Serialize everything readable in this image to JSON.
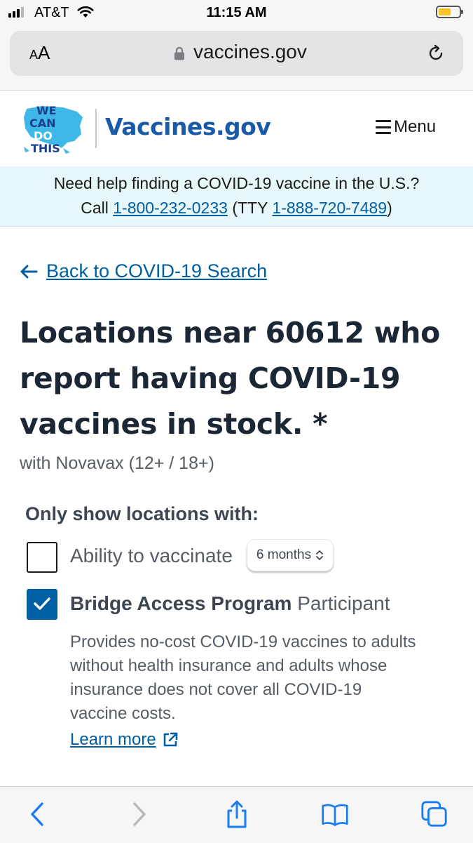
{
  "status_bar": {
    "carrier": "AT&T",
    "time": "11:15 AM"
  },
  "browser": {
    "text_size_label_small": "A",
    "text_size_label_large": "A",
    "url": "vaccines.gov"
  },
  "header": {
    "logo_text": [
      "WE",
      "CAN",
      "DO",
      "THIS"
    ],
    "site_title": "Vaccines.gov",
    "menu_label": "Menu"
  },
  "banner": {
    "line1": "Need help finding a COVID-19 vaccine in the U.S.?",
    "call_prefix": "Call",
    "phone": "1-800-232-0233",
    "tty_prefix": "(TTY",
    "tty_phone": "1-888-720-7489",
    "tty_suffix": ")"
  },
  "main": {
    "back_link": "Back to COVID-19 Search",
    "title_lines": [
      "Locations near 60612 who",
      "report having COVID-19",
      "vaccines in stock. *"
    ],
    "subtitle": "with Novavax (12+ / 18+)",
    "filter_legend": "Only show locations with:",
    "filter_age_label": "Ability to vaccinate",
    "filter_age_value": "6 months",
    "filter_bridge_bold": "Bridge Access Program",
    "filter_bridge_rest": "Participant",
    "bridge_desc_lines": [
      "Provides no-cost COVID-19 vaccines to adults",
      "without health insurance and adults whose",
      "insurance does not cover all COVID-19",
      "vaccine costs."
    ],
    "learn_more": "Learn more"
  },
  "colors": {
    "brand_blue": "#1a5aa8",
    "link_blue": "#005ea2",
    "banner_bg": "#e7f6f8",
    "checkbox_checked": "#005ea2",
    "battery": "#f7c52b"
  },
  "icons": [
    "signal-icon",
    "wifi-icon",
    "battery-icon",
    "lock-icon",
    "reload-icon",
    "menu-icon",
    "arrow-left-icon",
    "select-chevron-icon",
    "checkmark-icon",
    "external-link-icon",
    "back-icon",
    "forward-icon",
    "share-icon",
    "bookmarks-icon",
    "tabs-icon"
  ],
  "states": {
    "age_checkbox_checked": false,
    "bridge_checkbox_checked": true
  }
}
